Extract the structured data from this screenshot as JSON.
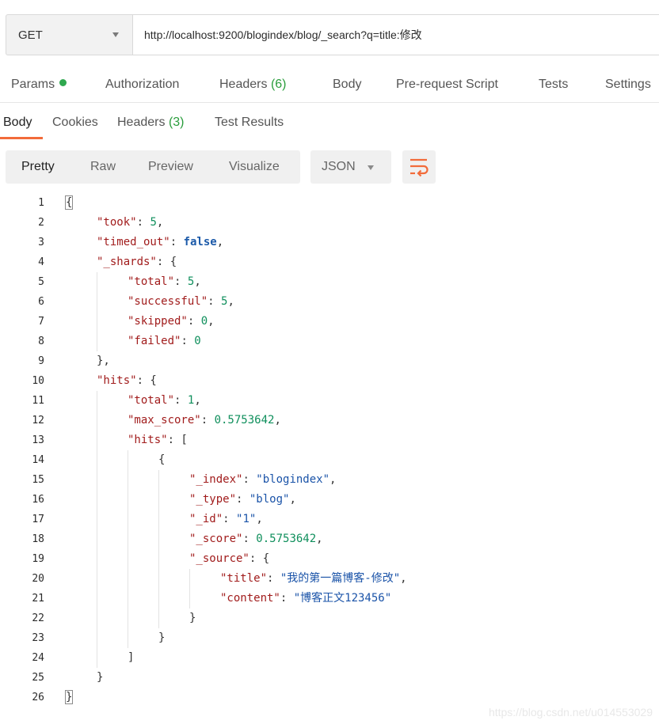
{
  "request": {
    "method": "GET",
    "url": "http://localhost:9200/blogindex/blog/_search?q=title:修改"
  },
  "request_tabs": {
    "params": "Params",
    "authorization": "Authorization",
    "headers": "Headers",
    "headers_count": "(6)",
    "body": "Body",
    "pre_request": "Pre-request Script",
    "tests": "Tests",
    "settings": "Settings"
  },
  "response_tabs": {
    "body": "Body",
    "cookies": "Cookies",
    "headers": "Headers",
    "headers_count": "(3)",
    "test_results": "Test Results"
  },
  "view": {
    "pretty": "Pretty",
    "raw": "Raw",
    "preview": "Preview",
    "visualize": "Visualize",
    "format": "JSON"
  },
  "code_lines": [
    {
      "n": "1",
      "indent": 0,
      "tokens": [
        {
          "t": "{",
          "c": "p"
        }
      ]
    },
    {
      "n": "2",
      "indent": 1,
      "tokens": [
        {
          "t": "\"took\"",
          "c": "k"
        },
        {
          "t": ": ",
          "c": "p"
        },
        {
          "t": "5",
          "c": "n"
        },
        {
          "t": ",",
          "c": "p"
        }
      ]
    },
    {
      "n": "3",
      "indent": 1,
      "tokens": [
        {
          "t": "\"timed_out\"",
          "c": "k"
        },
        {
          "t": ": ",
          "c": "p"
        },
        {
          "t": "false",
          "c": "b"
        },
        {
          "t": ",",
          "c": "p"
        }
      ]
    },
    {
      "n": "4",
      "indent": 1,
      "tokens": [
        {
          "t": "\"_shards\"",
          "c": "k"
        },
        {
          "t": ": {",
          "c": "p"
        }
      ]
    },
    {
      "n": "5",
      "indent": 2,
      "tokens": [
        {
          "t": "\"total\"",
          "c": "k"
        },
        {
          "t": ": ",
          "c": "p"
        },
        {
          "t": "5",
          "c": "n"
        },
        {
          "t": ",",
          "c": "p"
        }
      ]
    },
    {
      "n": "6",
      "indent": 2,
      "tokens": [
        {
          "t": "\"successful\"",
          "c": "k"
        },
        {
          "t": ": ",
          "c": "p"
        },
        {
          "t": "5",
          "c": "n"
        },
        {
          "t": ",",
          "c": "p"
        }
      ]
    },
    {
      "n": "7",
      "indent": 2,
      "tokens": [
        {
          "t": "\"skipped\"",
          "c": "k"
        },
        {
          "t": ": ",
          "c": "p"
        },
        {
          "t": "0",
          "c": "n"
        },
        {
          "t": ",",
          "c": "p"
        }
      ]
    },
    {
      "n": "8",
      "indent": 2,
      "tokens": [
        {
          "t": "\"failed\"",
          "c": "k"
        },
        {
          "t": ": ",
          "c": "p"
        },
        {
          "t": "0",
          "c": "n"
        }
      ]
    },
    {
      "n": "9",
      "indent": 1,
      "tokens": [
        {
          "t": "},",
          "c": "p"
        }
      ]
    },
    {
      "n": "10",
      "indent": 1,
      "tokens": [
        {
          "t": "\"hits\"",
          "c": "k"
        },
        {
          "t": ": {",
          "c": "p"
        }
      ]
    },
    {
      "n": "11",
      "indent": 2,
      "tokens": [
        {
          "t": "\"total\"",
          "c": "k"
        },
        {
          "t": ": ",
          "c": "p"
        },
        {
          "t": "1",
          "c": "n"
        },
        {
          "t": ",",
          "c": "p"
        }
      ]
    },
    {
      "n": "12",
      "indent": 2,
      "tokens": [
        {
          "t": "\"max_score\"",
          "c": "k"
        },
        {
          "t": ": ",
          "c": "p"
        },
        {
          "t": "0.5753642",
          "c": "n"
        },
        {
          "t": ",",
          "c": "p"
        }
      ]
    },
    {
      "n": "13",
      "indent": 2,
      "tokens": [
        {
          "t": "\"hits\"",
          "c": "k"
        },
        {
          "t": ": [",
          "c": "p"
        }
      ]
    },
    {
      "n": "14",
      "indent": 3,
      "tokens": [
        {
          "t": "{",
          "c": "p"
        }
      ]
    },
    {
      "n": "15",
      "indent": 4,
      "tokens": [
        {
          "t": "\"_index\"",
          "c": "k"
        },
        {
          "t": ": ",
          "c": "p"
        },
        {
          "t": "\"blogindex\"",
          "c": "s"
        },
        {
          "t": ",",
          "c": "p"
        }
      ]
    },
    {
      "n": "16",
      "indent": 4,
      "tokens": [
        {
          "t": "\"_type\"",
          "c": "k"
        },
        {
          "t": ": ",
          "c": "p"
        },
        {
          "t": "\"blog\"",
          "c": "s"
        },
        {
          "t": ",",
          "c": "p"
        }
      ]
    },
    {
      "n": "17",
      "indent": 4,
      "tokens": [
        {
          "t": "\"_id\"",
          "c": "k"
        },
        {
          "t": ": ",
          "c": "p"
        },
        {
          "t": "\"1\"",
          "c": "s"
        },
        {
          "t": ",",
          "c": "p"
        }
      ]
    },
    {
      "n": "18",
      "indent": 4,
      "tokens": [
        {
          "t": "\"_score\"",
          "c": "k"
        },
        {
          "t": ": ",
          "c": "p"
        },
        {
          "t": "0.5753642",
          "c": "n"
        },
        {
          "t": ",",
          "c": "p"
        }
      ]
    },
    {
      "n": "19",
      "indent": 4,
      "tokens": [
        {
          "t": "\"_source\"",
          "c": "k"
        },
        {
          "t": ": {",
          "c": "p"
        }
      ]
    },
    {
      "n": "20",
      "indent": 5,
      "tokens": [
        {
          "t": "\"title\"",
          "c": "k"
        },
        {
          "t": ": ",
          "c": "p"
        },
        {
          "t": "\"我的第一篇博客-修改\"",
          "c": "s"
        },
        {
          "t": ",",
          "c": "p"
        }
      ]
    },
    {
      "n": "21",
      "indent": 5,
      "tokens": [
        {
          "t": "\"content\"",
          "c": "k"
        },
        {
          "t": ": ",
          "c": "p"
        },
        {
          "t": "\"博客正文123456\"",
          "c": "s"
        }
      ]
    },
    {
      "n": "22",
      "indent": 4,
      "tokens": [
        {
          "t": "}",
          "c": "p"
        }
      ]
    },
    {
      "n": "23",
      "indent": 3,
      "tokens": [
        {
          "t": "}",
          "c": "p"
        }
      ]
    },
    {
      "n": "24",
      "indent": 2,
      "tokens": [
        {
          "t": "]",
          "c": "p"
        }
      ]
    },
    {
      "n": "25",
      "indent": 1,
      "tokens": [
        {
          "t": "}",
          "c": "p"
        }
      ]
    },
    {
      "n": "26",
      "indent": 0,
      "tokens": [
        {
          "t": "}",
          "c": "p"
        }
      ]
    }
  ],
  "watermark": "https://blog.csdn.net/u014553029",
  "colors": {
    "accent": "#f26b3a",
    "status_dot": "#2fa84f",
    "key": "#a11c1c",
    "string": "#1a53a8",
    "number": "#0f8f5c"
  },
  "icons": {
    "method_dropdown": "chevron-down-icon",
    "format_dropdown": "chevron-down-icon",
    "wrap": "wrap-lines-icon"
  }
}
